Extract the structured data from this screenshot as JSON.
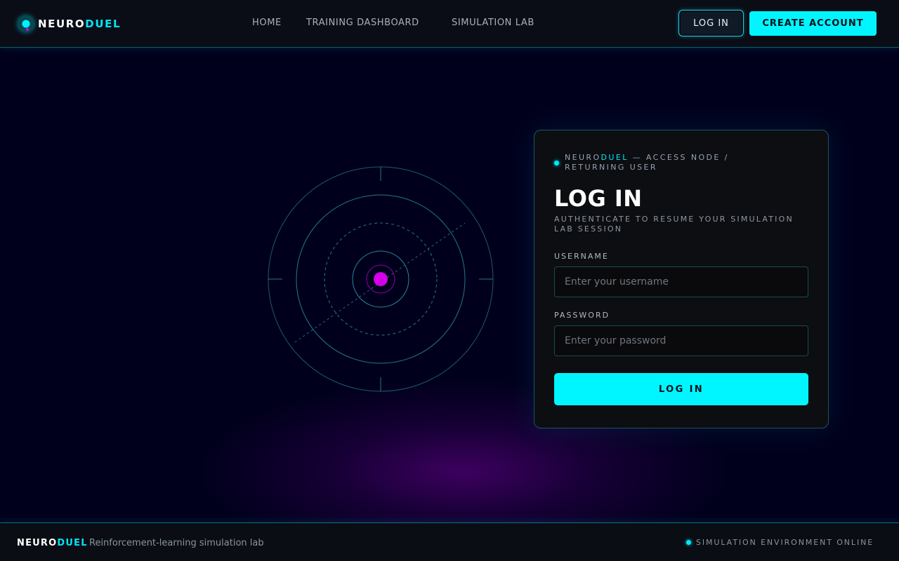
{
  "brand": {
    "name_part1": "NEURO",
    "name_part2": "DUEL"
  },
  "nav": {
    "items": [
      {
        "label": "HOME"
      },
      {
        "label": "TRAINING DASHBOARD"
      },
      {
        "label": "SIMULATION LAB"
      }
    ]
  },
  "header_actions": {
    "login_label": "LOG IN",
    "create_label": "CREATE ACCOUNT"
  },
  "login_card": {
    "kicker_brand1": "NEURO",
    "kicker_brand2": "DUEL",
    "kicker_rest": " — ACCESS NODE / RETURNING USER",
    "title": "LOG IN",
    "subtitle": "AUTHENTICATE TO RESUME YOUR SIMULATION LAB SESSION",
    "username_label": "USERNAME",
    "username_placeholder": "Enter your username",
    "password_label": "PASSWORD",
    "password_placeholder": "Enter your password",
    "submit_label": "LOG IN"
  },
  "footer": {
    "brand1": "NEURO",
    "brand2": "DUEL",
    "tagline": "Reinforcement-learning simulation lab",
    "status": "SIMULATION ENVIRONMENT ONLINE"
  },
  "colors": {
    "accent_cyan": "#00f6ff",
    "accent_magenta": "#d400e8",
    "background": "#01001c",
    "panel": "#0c0e12"
  }
}
